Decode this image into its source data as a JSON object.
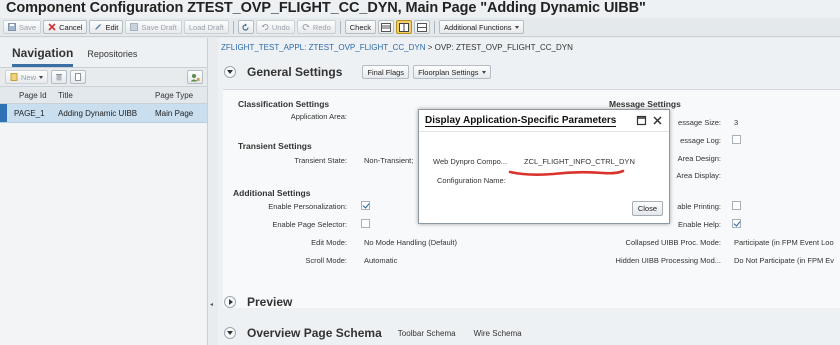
{
  "window": {
    "title": "Component Configuration ZTEST_OVP_FLIGHT_CC_DYN, Main Page \"Adding Dynamic UIBB\""
  },
  "toolbar": {
    "save": "Save",
    "cancel": "Cancel",
    "edit": "Edit",
    "save_draft": "Save Draft",
    "load_draft": "Load Draft",
    "undo": "Undo",
    "redo": "Redo",
    "check": "Check",
    "additional_functions": "Additional Functions"
  },
  "navigation": {
    "tab_nav": "Navigation",
    "tab_repo": "Repositories",
    "new_label": "New",
    "columns": {
      "page_id": "Page Id",
      "title": "Title",
      "page_type": "Page Type"
    },
    "rows": [
      {
        "page_id": "PAGE_1",
        "title": "Adding Dynamic UIBB",
        "page_type": "Main Page"
      }
    ]
  },
  "breadcrumb": {
    "link": "ZFLIGHT_TEST_APPL: ZTEST_OVP_FLIGHT_CC_DYN",
    "rest": " > OVP: ZTEST_OVP_FLIGHT_CC_DYN"
  },
  "general_settings": {
    "title": "General Settings",
    "final_flags": "Final Flags",
    "floorplan_settings": "Floorplan Settings",
    "classification": {
      "title": "Classification Settings",
      "application_area_label": "Application Area:"
    },
    "message": {
      "title": "Message Settings",
      "size_label": "essage Size:",
      "size_value": "3",
      "log_label": "essage Log:",
      "area_design_label": "Area Design:",
      "area_display_label": "Area Display:"
    },
    "transient": {
      "title": "Transient Settings",
      "state_label": "Transient State:",
      "state_value": "Non-Transient;"
    },
    "additional": {
      "title": "Additional Settings",
      "personalization_label": "Enable Personalization:",
      "page_selector_label": "Enable Page Selector:",
      "edit_mode_label": "Edit Mode:",
      "edit_mode_value": "No Mode Handling (Default)",
      "scroll_mode_label": "Scroll Mode:",
      "scroll_mode_value": "Automatic",
      "printing_label": "able Printing:",
      "help_label": "Enable Help:",
      "collapsed_label": "Collapsed UIBB Proc. Mode:",
      "collapsed_value": "Participate (in FPM Event Loo",
      "hidden_label": "Hidden UIBB Processing Mod...",
      "hidden_value": "Do Not Participate (in FPM Ev"
    }
  },
  "preview": {
    "title": "Preview"
  },
  "overview_schema": {
    "title": "Overview Page Schema",
    "toolbar_schema": "Toolbar Schema",
    "wire_schema": "Wire Schema"
  },
  "dialog": {
    "title": "Display Application-Specific Parameters",
    "component_label": "Web Dynpro Compo...",
    "component_value": "ZCL_FLIGHT_INFO_CTRL_DYN",
    "config_name_label": "Configuration Name:",
    "close": "Close"
  }
}
